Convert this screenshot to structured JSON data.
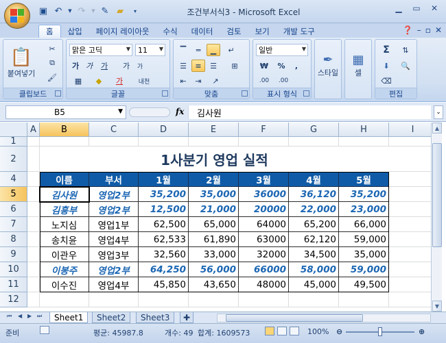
{
  "window": {
    "title": "조건부서식3 - Microsoft Excel"
  },
  "ribbon": {
    "tabs": [
      "홈",
      "삽입",
      "페이지 레이아웃",
      "수식",
      "데이터",
      "검토",
      "보기",
      "개발 도구"
    ],
    "clipboard": {
      "paste_label": "붙여넣기",
      "group_label": "클립보드"
    },
    "font": {
      "name": "맑은 고딕",
      "size": "11",
      "bold": "가",
      "italic": "가",
      "underline": "가",
      "grow": "가",
      "shrink": "가",
      "font_color": "가",
      "phonetic": "내천",
      "group_label": "글꼴"
    },
    "align": {
      "group_label": "맞춤"
    },
    "number": {
      "format": "일반",
      "currency": "₩",
      "percent": "%",
      "comma": ",",
      "inc_dec": ".00",
      "dec_dec": ".00",
      "group_label": "표시 형식"
    },
    "style": {
      "label": "스타일"
    },
    "cells": {
      "label": "셀"
    },
    "editing": {
      "group_label": "편집",
      "sum": "Σ"
    }
  },
  "formula_bar": {
    "name_box": "B5",
    "fx": "fx",
    "content": "김사원"
  },
  "grid": {
    "columns": [
      "A",
      "B",
      "C",
      "D",
      "E",
      "F",
      "G",
      "H",
      "I"
    ],
    "rows": [
      "1",
      "2",
      "4",
      "5",
      "6",
      "7",
      "8",
      "9",
      "10",
      "11",
      "12"
    ],
    "title": "1사분기 영업 실적",
    "headers": [
      "이름",
      "부서",
      "1월",
      "2월",
      "3월",
      "4월",
      "5월"
    ],
    "data": [
      [
        "김사원",
        "영업2부",
        "35,200",
        "35,000",
        "36000",
        "36,120",
        "35,200"
      ],
      [
        "김흥부",
        "영업2부",
        "12,500",
        "21,000",
        "20000",
        "22,000",
        "23,000"
      ],
      [
        "노지심",
        "영업1부",
        "62,500",
        "65,000",
        "64000",
        "65,200",
        "66,000"
      ],
      [
        "송치윤",
        "영업4부",
        "62,533",
        "61,890",
        "63000",
        "62,120",
        "59,000"
      ],
      [
        "이관우",
        "영업3부",
        "32,560",
        "33,000",
        "32000",
        "34,500",
        "35,000"
      ],
      [
        "이봉주",
        "영업2부",
        "64,250",
        "56,000",
        "66000",
        "58,000",
        "59,000"
      ],
      [
        "이수진",
        "영업4부",
        "45,850",
        "43,650",
        "48000",
        "45,000",
        "49,500"
      ]
    ],
    "highlight_rows": [
      0,
      1,
      5
    ]
  },
  "sheets": {
    "tabs": [
      "Sheet1",
      "Sheet2",
      "Sheet3"
    ],
    "active": "Sheet1"
  },
  "status": {
    "mode": "준비",
    "average": "평균: 45987.8",
    "count": "개수: 49",
    "sum": "합계: 1609573",
    "zoom": "100%"
  },
  "colors": {
    "header_fill": "#0f5ba7",
    "highlight_text": "#1b66b3",
    "selected_header": "#f6c35c"
  }
}
